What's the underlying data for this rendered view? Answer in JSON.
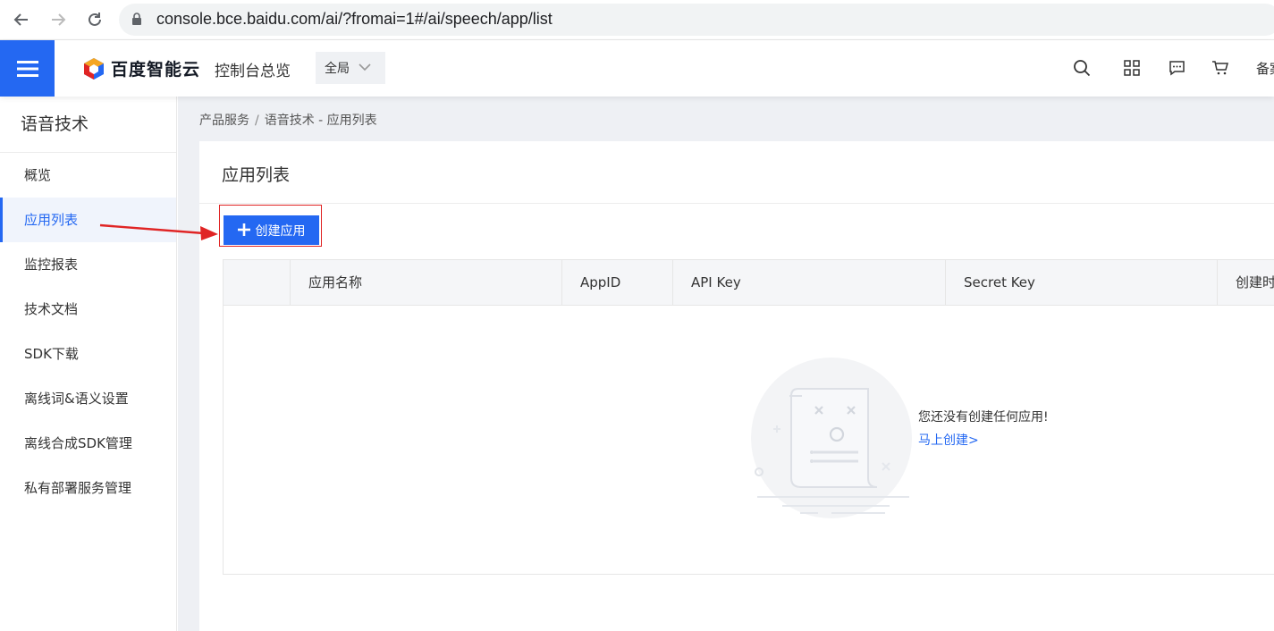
{
  "browser": {
    "url": "console.bce.baidu.com/ai/?fromai=1#/ai/speech/app/list"
  },
  "header": {
    "logo_text": "百度智能云",
    "console_link": "控制台总览",
    "region": "全局",
    "right_text": "备案"
  },
  "sidebar": {
    "title": "语音技术",
    "items": [
      {
        "label": "概览"
      },
      {
        "label": "应用列表"
      },
      {
        "label": "监控报表"
      },
      {
        "label": "技术文档"
      },
      {
        "label": "SDK下载"
      },
      {
        "label": "离线词&语义设置"
      },
      {
        "label": "离线合成SDK管理"
      },
      {
        "label": "私有部署服务管理"
      }
    ],
    "active_index": 1
  },
  "breadcrumb": {
    "root": "产品服务",
    "separator": "/",
    "current": "语音技术 - 应用列表"
  },
  "main": {
    "title": "应用列表",
    "create_button": "创建应用",
    "table": {
      "columns": [
        "应用名称",
        "AppID",
        "API Key",
        "Secret Key",
        "创建时间"
      ]
    },
    "empty": {
      "message": "您还没有创建任何应用!",
      "link": "马上创建>"
    }
  },
  "colors": {
    "accent": "#2468f2",
    "annotation": "#e02424"
  },
  "icons": [
    "back-icon",
    "forward-icon",
    "reload-icon",
    "lock-icon",
    "menu-icon",
    "search-icon",
    "qrcode-icon",
    "message-icon",
    "cart-icon",
    "chevron-down-icon",
    "plus-icon",
    "empty-document-illustration"
  ]
}
